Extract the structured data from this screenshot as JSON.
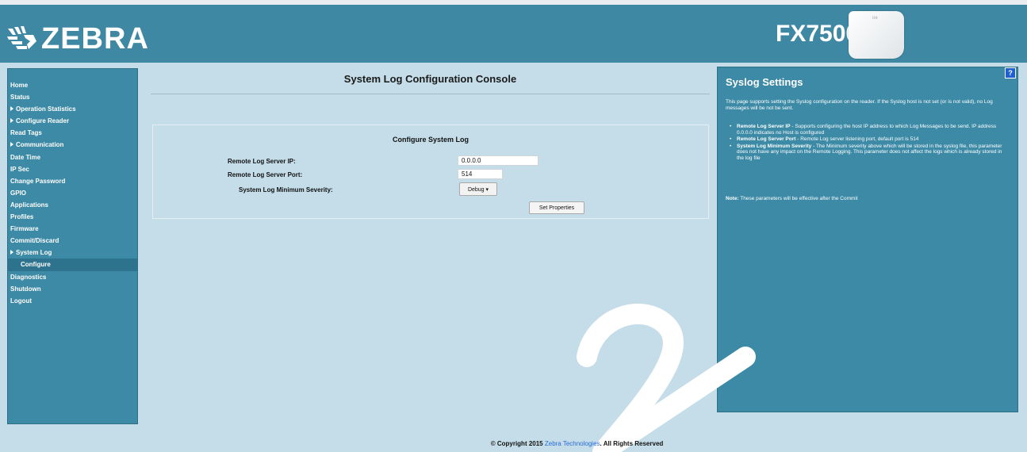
{
  "header": {
    "logo_text": "ZEBRA",
    "model": "FX7500",
    "bg_color": "#3f88a4"
  },
  "sidebar": {
    "items": [
      {
        "label": "Home",
        "expandable": false
      },
      {
        "label": "Status",
        "expandable": false
      },
      {
        "label": "Operation Statistics",
        "expandable": true
      },
      {
        "label": "Configure Reader",
        "expandable": true
      },
      {
        "label": "Read Tags",
        "expandable": false
      },
      {
        "label": "Communication",
        "expandable": true
      },
      {
        "label": "Date Time",
        "expandable": false
      },
      {
        "label": "IP Sec",
        "expandable": false
      },
      {
        "label": "Change Password",
        "expandable": false
      },
      {
        "label": "GPIO",
        "expandable": false
      },
      {
        "label": "Applications",
        "expandable": false
      },
      {
        "label": "Profiles",
        "expandable": false
      },
      {
        "label": "Firmware",
        "expandable": false
      },
      {
        "label": "Commit/Discard",
        "expandable": false
      },
      {
        "label": "System Log",
        "expandable": true
      },
      {
        "label": "Configure",
        "expandable": false,
        "sub": true,
        "selected": true
      },
      {
        "label": "Diagnostics",
        "expandable": false
      },
      {
        "label": "Shutdown",
        "expandable": false
      },
      {
        "label": "Logout",
        "expandable": false
      }
    ]
  },
  "main": {
    "title": "System Log Configuration Console",
    "form": {
      "title": "Configure System Log",
      "ip_label": "Remote Log Server IP:",
      "ip_value": "0.0.0.0",
      "port_label": "Remote Log Server Port:",
      "port_value": "514",
      "severity_label": "System Log Minimum Severity:",
      "severity_value": "Debug",
      "set_button": "Set Properties"
    }
  },
  "help": {
    "icon": "?",
    "title": "Syslog Settings",
    "intro": "This page supports setting the Syslog configuration on the reader. If the Syslog host is not set (or is not valid), no Log messages will be not be sent.",
    "items": [
      {
        "term": "Remote Log Server IP",
        "desc": " - Supports configuring the host IP address to which Log Messages to be send. IP address 0.0.0.0 indicates no Host is configured"
      },
      {
        "term": "Remote Log Server Port",
        "desc": " - Remote Log server listening port, default port is 514"
      },
      {
        "term": "System Log Minimum Severity",
        "desc": " - The Minimum severity above which will be stored in the syslog file, this parameter does not have any impact on the Remote Logging. This parameter does not affect the logs which is already stored in the log file"
      }
    ],
    "note_label": "Note:",
    "note_text": " These parameters will be effective after the Commit"
  },
  "footer": {
    "prefix": "© Copyright 2015 ",
    "link": "Zebra Technologies",
    "suffix": ". All Rights Reserved"
  },
  "colors": {
    "page_bg": "#c4dde8",
    "panel": "#3c8aa6",
    "link": "#2a6bd6"
  }
}
